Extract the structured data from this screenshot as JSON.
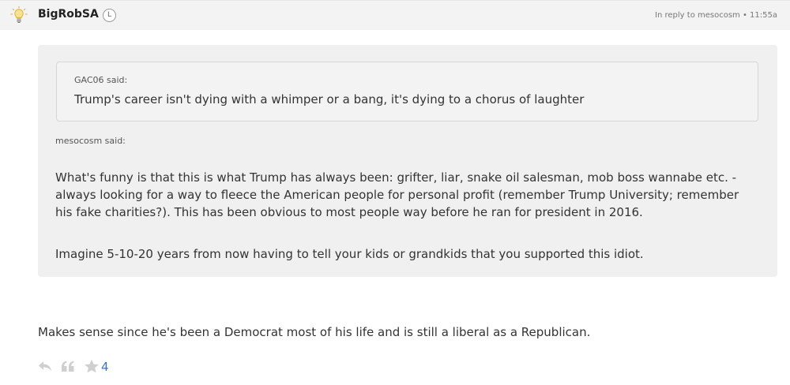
{
  "post": {
    "username": "BigRobSA",
    "badge": "L",
    "reply_info": "In reply to mesocosm • 11:55a"
  },
  "quote": {
    "nested": {
      "author_said": "GAC06 said:",
      "text": "Trump's career isn't dying with a whimper or a bang, it's dying to a chorus of laughter"
    },
    "author_said": "mesocosm said:",
    "paragraphs": [
      "What's funny is that this is what Trump has always been: grifter, liar, snake oil salesman, mob boss wannabe etc. - always looking for a way to fleece the American people for personal profit (remember Trump University; remember his fake charities?). This has been obvious to most people way before he ran for president in 2016.",
      "Imagine 5-10-20 years from now having to tell your kids or grandkids that you supported this idiot."
    ]
  },
  "body": "Makes sense since he's been a Democrat most of his life and is still a liberal as a Republican.",
  "actions": {
    "star_count": "4",
    "icons": [
      "reply-icon",
      "quote-icon",
      "star-icon"
    ]
  },
  "colors": {
    "header_bg": "#f3f3f3",
    "quote_bg": "#f0f0f0",
    "link_blue": "#3a76b8",
    "action_icon": "#cfcfcf"
  }
}
